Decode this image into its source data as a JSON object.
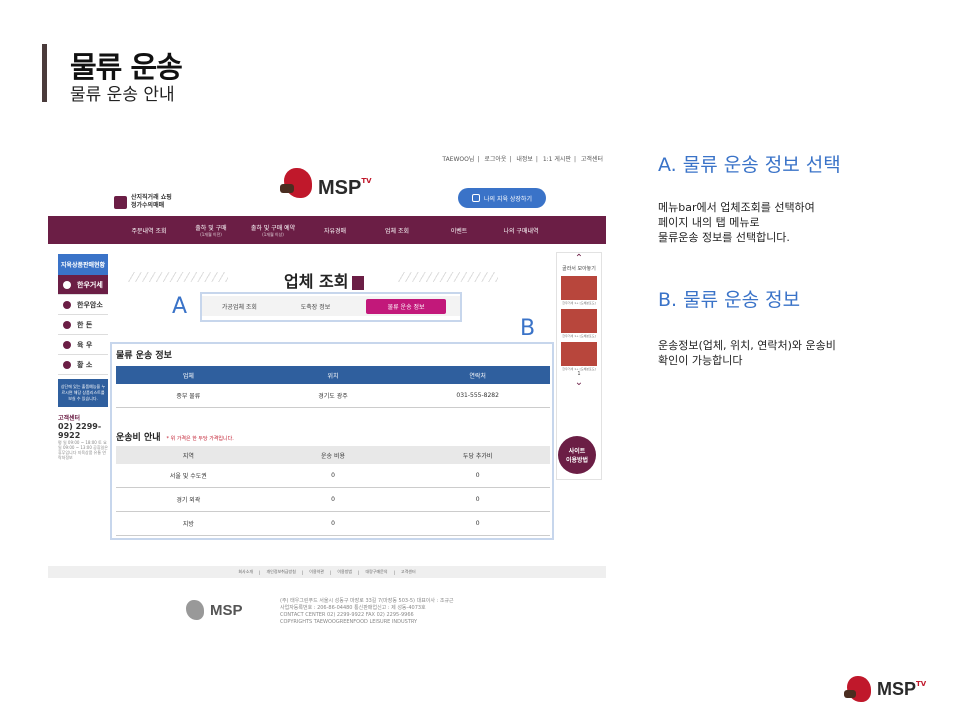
{
  "slide": {
    "title": "물류 운송",
    "subtitle": "물류 운송 안내"
  },
  "shot": {
    "topnav": [
      "TAEWOO님",
      "로그아웃",
      "내정보",
      "1:1 게시판",
      "고객센터"
    ],
    "badge": [
      "산지직거래 쇼핑",
      "정가수의매매"
    ],
    "logo": {
      "word": "MSP",
      "tv": "TV"
    },
    "myinfo_button": "나의 지육 상장하기",
    "menu": [
      {
        "label": "주문내역 조회",
        "sub": ""
      },
      {
        "label": "출하 및 구매",
        "sub": "(1개월 이전)"
      },
      {
        "label": "출하 및 구매 예약",
        "sub": "(1개월 이상)"
      },
      {
        "label": "자유경매",
        "sub": ""
      },
      {
        "label": "업체 조회",
        "sub": ""
      },
      {
        "label": "이벤트",
        "sub": ""
      },
      {
        "label": "나의 구매내역",
        "sub": ""
      }
    ],
    "left_sidebar": {
      "head": "지육상품판매현황",
      "items": [
        "한우거세",
        "한우암소",
        "한 돈",
        "육 우",
        "황 소"
      ],
      "note": "상단에 있는 출품예능을 누르시면 해당 상품리스트를 보실 수 있습니다.",
      "cs_label": "고객센터",
      "cs_tel": "02) 2299-9922",
      "cs_hours": "평 일 09:00 ~ 18:00  토 요일 09:00 ~ 13:00  공휴일은 휴무입니다  지육상품 유통 연락처정보"
    },
    "page_title": "업체 조회",
    "tabs": [
      "가공업체 조회",
      "도축장 정보",
      "물류 운송 정보"
    ],
    "active_tab": 2,
    "label_a": "A",
    "label_b": "B",
    "logistics": {
      "title": "물류 운송 정보",
      "headers": [
        "업체",
        "위치",
        "연락처"
      ],
      "rows": [
        [
          "중부 물류",
          "경기도 광주",
          "031-555-8282"
        ]
      ]
    },
    "fees": {
      "title": "운송비 안내",
      "note": "* 위 가격은 한 두당 가격입니다.",
      "headers": [
        "지역",
        "운송 비용",
        "두당 추가비"
      ],
      "rows": [
        [
          "서울 및 수도권",
          "0",
          "0"
        ],
        [
          "경기 외곽",
          "0",
          "0"
        ],
        [
          "지방",
          "0",
          "0"
        ]
      ]
    },
    "right_sidebar": {
      "title": "골라서 모아놓기",
      "captions": [
        "한우거세 1+ [도체분포도]",
        "한우거세 1+ [도체분포도]",
        "한우거세 1+ [도체분포도]"
      ],
      "pager": "1",
      "guide": [
        "사이트",
        "이용방법"
      ]
    },
    "footer_links": [
      "회사소개",
      "개인정보취급방침",
      "이용약관",
      "이용방법",
      "대량구매문의",
      "고객센터"
    ],
    "footer_logo": "MSP",
    "footer_info": [
      "(주) 태우그린푸드  서울시 성동구 마장로 33길 7(마장동 503-5)  대표이사 : 조규근",
      "사업자등록번호 : 206-86-04480  통신판매업신고 : 제 성동-4073호",
      "CONTACT CENTER 02) 2299-9922  FAX 02) 2295-9966",
      "COPYRIGHTS TAEWOOGREENFOOD LEISURE INDUSTRY"
    ]
  },
  "desc": {
    "a_title": "A. 물류 운송 정보 선택",
    "a_body": "메뉴bar에서 업체조회를 선택하여\n페이지 내의 탭 메뉴로\n물류운송 정보를 선택합니다.",
    "b_title": "B. 물류 운송 정보",
    "b_body": "운송정보(업체, 위치, 연락처)와 운송비\n확인이 가능합니다"
  },
  "brand": {
    "word": "MSP",
    "tv": "TV"
  },
  "colors": {
    "accent": "#3a73c8",
    "brand": "#6b1e45",
    "tab_active": "#c2187a",
    "table_header": "#2f5f9e"
  }
}
